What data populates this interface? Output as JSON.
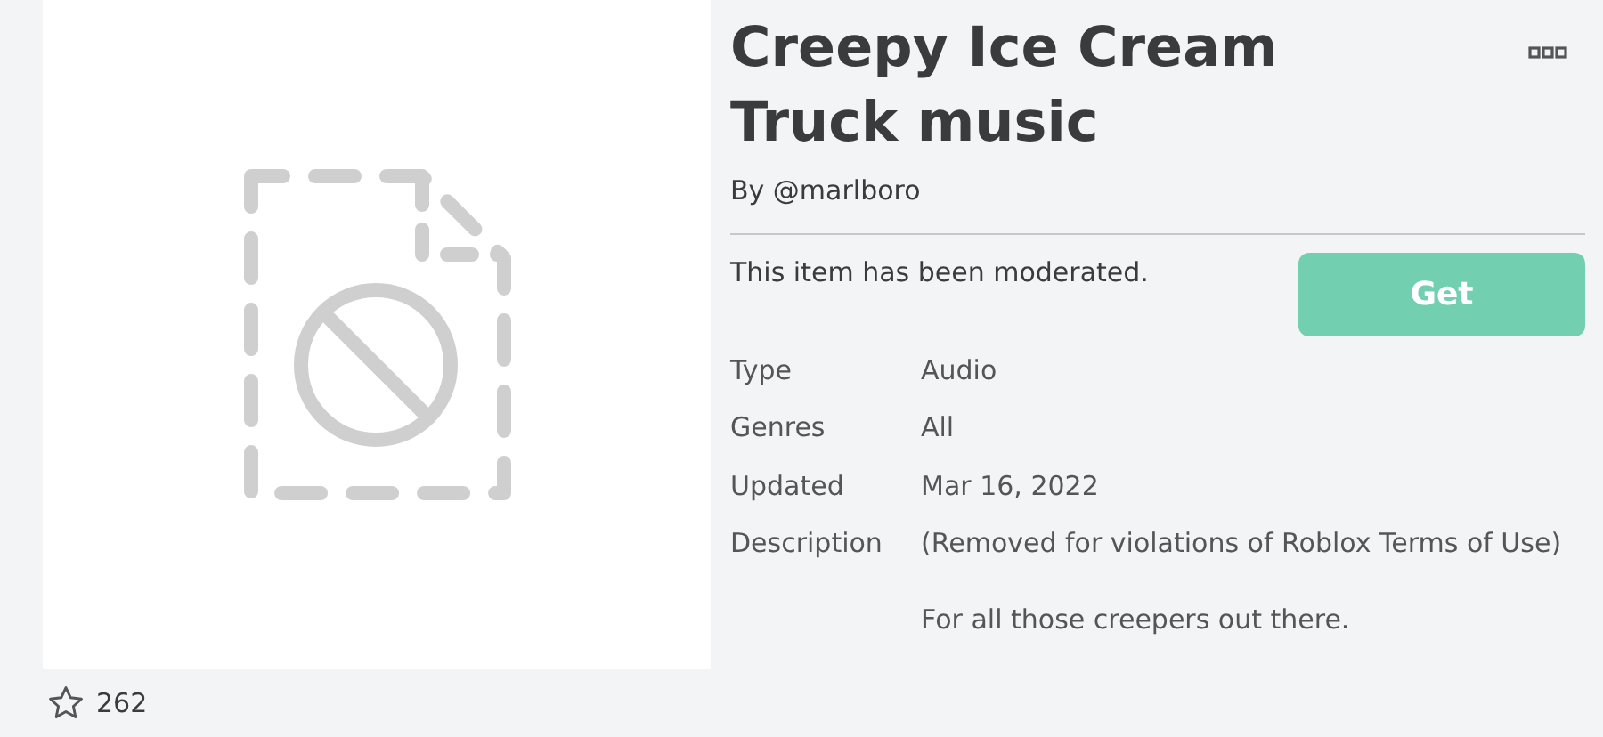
{
  "item": {
    "title": "Creepy Ice Cream Truck music",
    "creator": "By @marlboro"
  },
  "moderation_notice": "This item has been moderated.",
  "get_button": {
    "label": "Get"
  },
  "details": [
    {
      "label": "Type",
      "value": "Audio"
    },
    {
      "label": "Genres",
      "value": "All"
    },
    {
      "label": "Updated",
      "value": "Mar 16, 2022"
    },
    {
      "label": "Description",
      "value": "(Removed for violations of Roblox Terms of Use)",
      "extra": "For all those creepers out there."
    }
  ],
  "favorites": {
    "count": "262"
  }
}
